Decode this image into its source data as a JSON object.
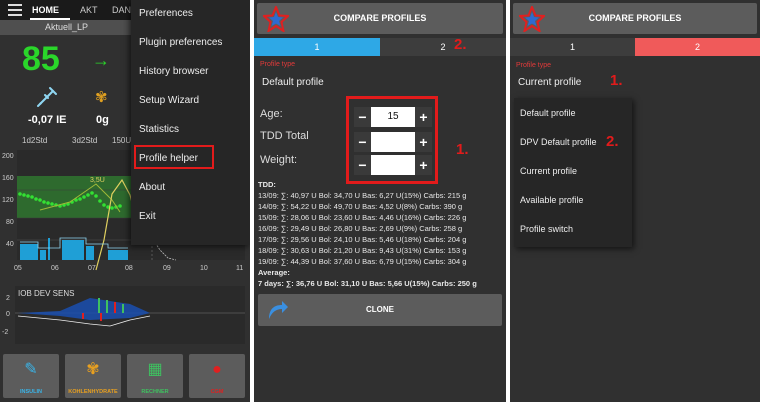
{
  "panel1": {
    "tabs": [
      "HOME",
      "AKT",
      "DANA"
    ],
    "profile_bar": "Aktuell_LP",
    "bg_value": "85",
    "trend_arrow": "→",
    "iob_value": "-0,07 IE",
    "cob_value": "0g",
    "basal_segments": [
      "1d2Std",
      "3d2Std",
      "150U"
    ],
    "chart": {
      "y_ticks": [
        "200",
        "160",
        "120",
        "80",
        "40"
      ],
      "x_ticks": [
        "05",
        "06",
        "07",
        "08",
        "09",
        "10",
        "11"
      ],
      "annotation": "3,5U",
      "secondary_label": "IOB DEV SENS",
      "secondary_ticks": [
        "2",
        "0",
        "-2"
      ]
    },
    "menu": {
      "items": [
        "Preferences",
        "Plugin preferences",
        "History browser",
        "Setup Wizard",
        "Statistics",
        "Profile helper",
        "About",
        "Exit"
      ],
      "highlighted": "Profile helper"
    },
    "buttons": [
      {
        "label": "INSULIN",
        "icon": "syringe-icon",
        "color": "#3ab4e8"
      },
      {
        "label": "KOHLENHYDRATE",
        "icon": "grain-icon",
        "color": "#e8a020"
      },
      {
        "label": "RECHNER",
        "icon": "calculator-icon",
        "color": "#3fc060"
      },
      {
        "label": "CGM",
        "icon": "drop-icon",
        "color": "#e02020"
      }
    ]
  },
  "panel2": {
    "title": "COMPARE PROFILES",
    "tabs": [
      "1",
      "2"
    ],
    "active_tab_color": "#2ea8e6",
    "tab_marker": "2.",
    "profile_type_label": "Profile type",
    "profile_type_value": "Default profile",
    "fields": [
      {
        "label": "Age:",
        "value": "15"
      },
      {
        "label": "TDD Total",
        "value": ""
      },
      {
        "label": "Weight:",
        "value": ""
      }
    ],
    "stepper_marker": "1.",
    "tdd_header": "TDD:",
    "tdd_rows": [
      "13/09: ∑: 40,97 U Bol: 34,70 U Bas: 6,27 U(15%) Carbs: 215 g",
      "14/09: ∑: 54,22 U Bol: 49,70 U Bas: 4,52 U(8%) Carbs: 390 g",
      "15/09: ∑: 28,06 U Bol: 23,60 U Bas: 4,46 U(16%) Carbs: 226 g",
      "16/09: ∑: 29,49 U Bol: 26,80 U Bas: 2,69 U(9%) Carbs: 258 g",
      "17/09: ∑: 29,56 U Bol: 24,10 U Bas: 5,46 U(18%) Carbs: 204 g",
      "18/09: ∑: 30,63 U Bol: 21,20 U Bas: 9,43 U(31%) Carbs: 153 g",
      "19/09: ∑: 44,39 U Bol: 37,60 U Bas: 6,79 U(15%) Carbs: 304 g"
    ],
    "average_label": "Average:",
    "average_row": "7 days: ∑: 36,76 U Bol: 31,10 U Bas: 5,66 U(15%) Carbs: 250 g",
    "clone_label": "CLONE"
  },
  "panel3": {
    "title": "COMPARE PROFILES",
    "tabs": [
      "1",
      "2"
    ],
    "active_tab_color": "#f05a5a",
    "profile_type_label": "Profile type",
    "profile_type_value": "Current profile",
    "marker_1": "1.",
    "marker_2": "2.",
    "options": [
      "Default profile",
      "DPV Default profile",
      "Current profile",
      "Available profile",
      "Profile switch"
    ]
  }
}
